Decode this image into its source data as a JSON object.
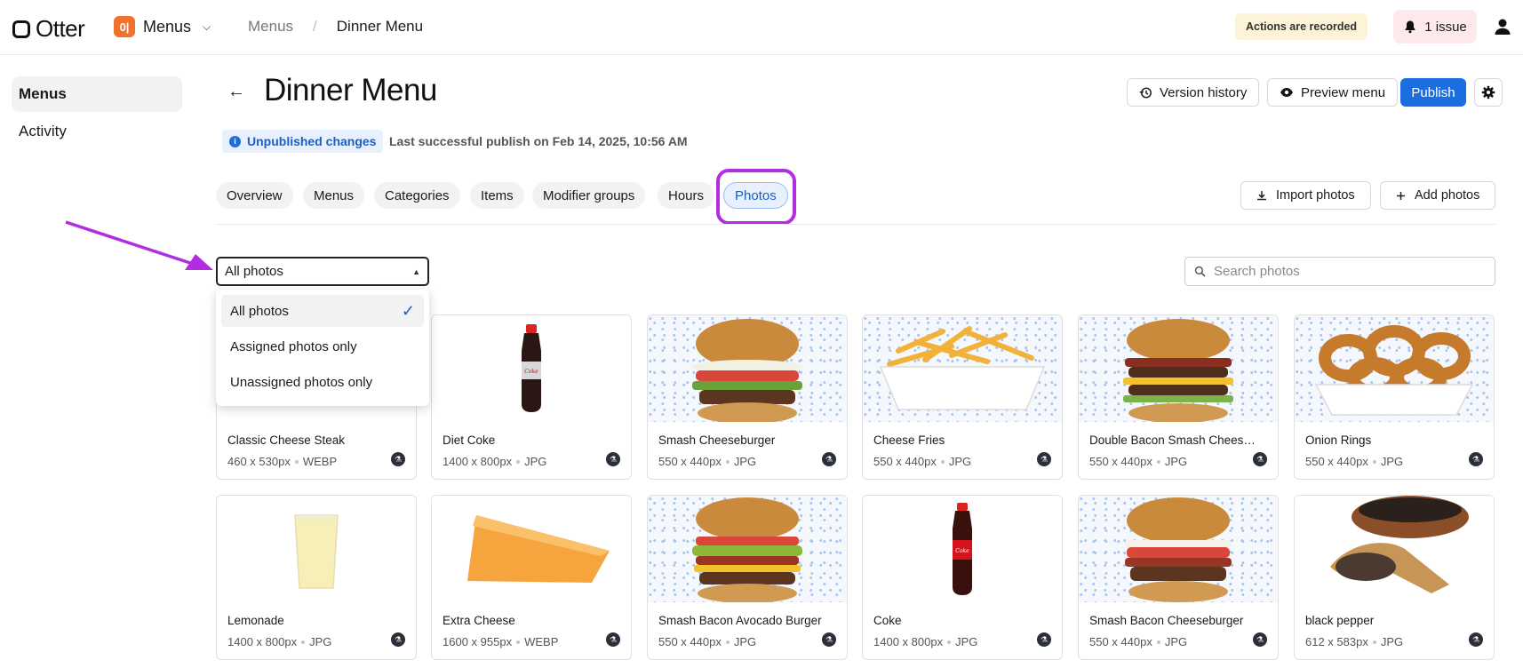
{
  "topbar": {
    "logo_text": "Otter",
    "app_icon_glyph": "0|",
    "app_name": "Menus",
    "breadcrumb_parent": "Menus",
    "breadcrumb_sep": "/",
    "breadcrumb_current": "Dinner Menu",
    "recorded_badge": "Actions are recorded",
    "issue_label": "1 issue"
  },
  "sidebar": {
    "items": [
      {
        "label": "Menus",
        "active": true
      },
      {
        "label": "Activity",
        "active": false
      }
    ]
  },
  "header": {
    "title": "Dinner Menu",
    "version_history": "Version history",
    "preview_menu": "Preview menu",
    "publish": "Publish",
    "unpublished_badge": "Unpublished changes",
    "last_publish": "Last successful publish on Feb 14, 2025, 10:56 AM"
  },
  "tabs": [
    {
      "label": "Overview"
    },
    {
      "label": "Menus"
    },
    {
      "label": "Categories"
    },
    {
      "label": "Items"
    },
    {
      "label": "Modifier groups"
    },
    {
      "label": "Hours"
    },
    {
      "label": "Photos",
      "active": true
    }
  ],
  "actions": {
    "import_photos": "Import photos",
    "add_photos": "Add photos"
  },
  "filter": {
    "selected": "All photos",
    "options": [
      {
        "label": "All photos",
        "selected": true
      },
      {
        "label": "Assigned photos only",
        "selected": false
      },
      {
        "label": "Unassigned photos only",
        "selected": false
      }
    ]
  },
  "search": {
    "placeholder": "Search photos"
  },
  "photos": [
    {
      "name": "Classic Cheese Steak",
      "dims": "460 x 530px",
      "format": "WEBP"
    },
    {
      "name": "Diet Coke",
      "dims": "1400 x 800px",
      "format": "JPG"
    },
    {
      "name": "Smash Cheeseburger",
      "dims": "550 x 440px",
      "format": "JPG"
    },
    {
      "name": "Cheese Fries",
      "dims": "550 x 440px",
      "format": "JPG"
    },
    {
      "name": "Double Bacon Smash Cheesebu...",
      "dims": "550 x 440px",
      "format": "JPG"
    },
    {
      "name": "Onion Rings",
      "dims": "550 x 440px",
      "format": "JPG"
    },
    {
      "name": "Lemonade",
      "dims": "1400 x 800px",
      "format": "JPG"
    },
    {
      "name": "Extra Cheese",
      "dims": "1600 x 955px",
      "format": "WEBP"
    },
    {
      "name": "Smash Bacon Avocado Burger",
      "dims": "550 x 440px",
      "format": "JPG"
    },
    {
      "name": "Coke",
      "dims": "1400 x 800px",
      "format": "JPG"
    },
    {
      "name": "Smash Bacon Cheeseburger",
      "dims": "550 x 440px",
      "format": "JPG"
    },
    {
      "name": "black pepper",
      "dims": "612 x 583px",
      "format": "JPG"
    }
  ],
  "colors": {
    "accent": "#1b6ee0",
    "annotation": "#b02ee0",
    "app_icon": "#f0722b",
    "recorded_bg": "#fdf3d9",
    "issue_bg": "#fde9ec"
  }
}
